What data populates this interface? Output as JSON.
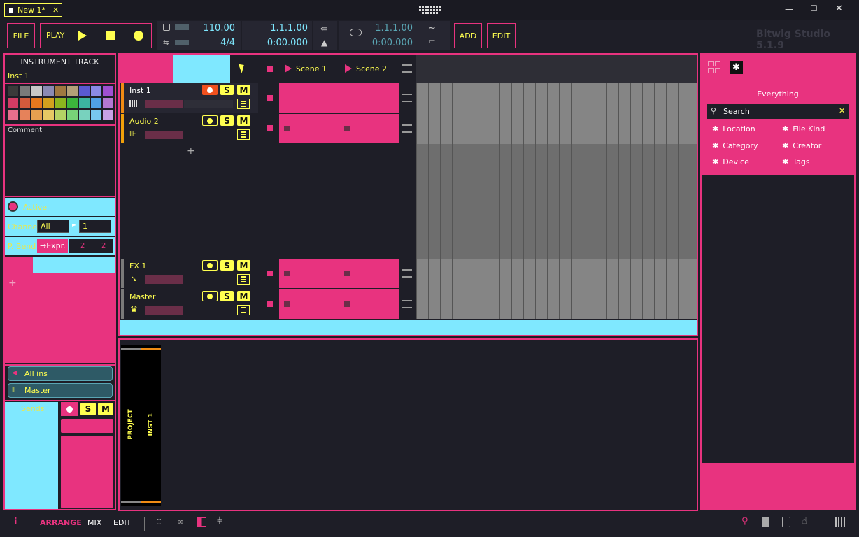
{
  "titlebar": {
    "tab_label": "New 1*",
    "tab_close": "✕",
    "app_version": "Bitwig Studio 5.1.9",
    "minimize": "—",
    "maximize": "☐",
    "close": "✕"
  },
  "transport": {
    "file": "FILE",
    "play": "PLAY",
    "tempo": "110.00",
    "time_signature": "4/4",
    "position_bars": "1.1.1.00",
    "position_time": "0:00.000",
    "loop_start": "1.1.1.00",
    "loop_length": "0:00.000",
    "add": "ADD",
    "edit": "EDIT"
  },
  "inspector": {
    "header": "INSTRUMENT TRACK",
    "track_name": "Inst 1",
    "comment_label": "Comment",
    "active_label": "Active",
    "channel_label": "Channel",
    "channel_value": "All",
    "channel_num": "1",
    "pbend_label": "P. Bend",
    "pbend_value": "→Expr.",
    "pbend_a": "2",
    "pbend_b": "2",
    "input_label": "All ins",
    "output_label": "Master",
    "sends_label": "Sends",
    "palette": [
      "#3a3a3a",
      "#7a7a7a",
      "#c8c8c8",
      "#8a8ab4",
      "#a07840",
      "#b4a078",
      "#5a5ad2",
      "#8a8ae6",
      "#a050d2",
      "#d23c64",
      "#d25a3c",
      "#e6781e",
      "#d2a01e",
      "#8cb41e",
      "#3cb43c",
      "#3cb4a0",
      "#50a0e6",
      "#b478d2",
      "#e66e8c",
      "#e6825a",
      "#e6a050",
      "#e6c864",
      "#b4d264",
      "#78d278",
      "#78d2be",
      "#78c8f0",
      "#c8a0e6"
    ]
  },
  "tracks": [
    {
      "name": "Inst 1",
      "type": "instrument",
      "color": "#f08c14"
    },
    {
      "name": "Audio 2",
      "type": "audio",
      "color": "#f0a00a"
    },
    {
      "name": "FX 1",
      "type": "fx",
      "color": "#7a7a7a"
    },
    {
      "name": "Master",
      "type": "master",
      "color": "#7a7a7a"
    }
  ],
  "scenes": [
    {
      "name": "Scene 1"
    },
    {
      "name": "Scene 2"
    }
  ],
  "track_buttons": {
    "solo": "S",
    "mute": "M"
  },
  "add_track": "+",
  "browser": {
    "title": "Everything",
    "search_placeholder": "Search",
    "filters": [
      "Location",
      "File Kind",
      "Category",
      "Creator",
      "Device",
      "Tags"
    ]
  },
  "bottom_panel": {
    "labels": [
      "PROJECT",
      "INST 1"
    ]
  },
  "statusbar": {
    "info": "i",
    "arrange": "ARRANGE",
    "mix": "MIX",
    "edit": "EDIT"
  },
  "colors": {
    "accent": "#e8337f",
    "cyan": "#7fe8ff",
    "yellow": "#ffff50",
    "bg": "#1e1e27"
  }
}
